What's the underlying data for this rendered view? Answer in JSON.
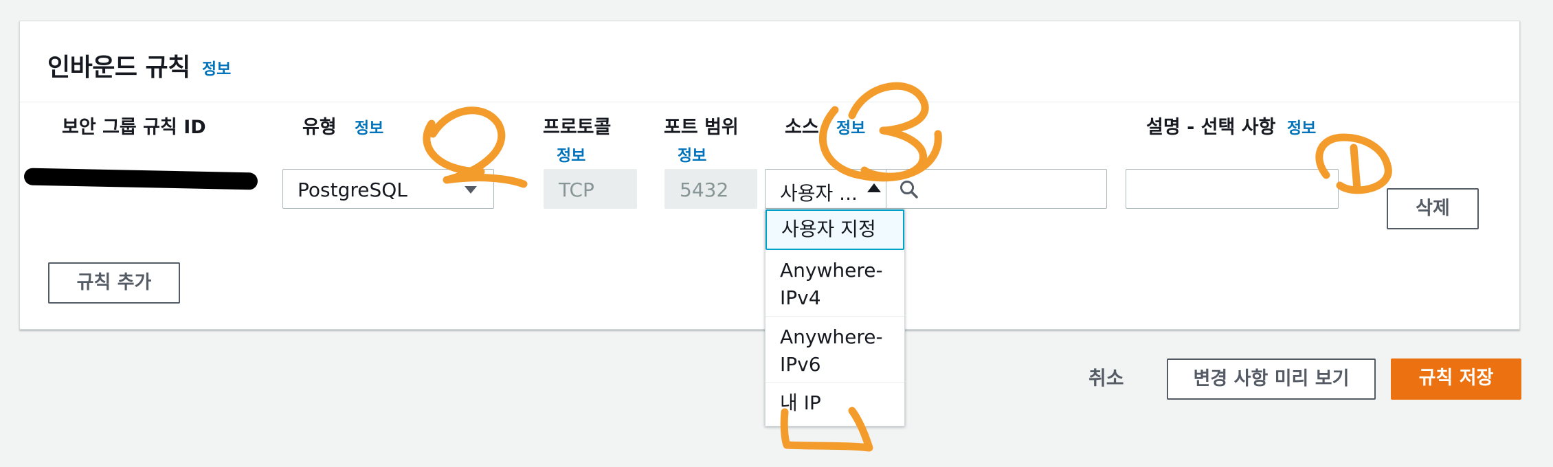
{
  "panel": {
    "title": "인바운드 규칙",
    "title_info": "정보"
  },
  "columns": {
    "rule_id": {
      "label": "보안 그룹 규칙 ID"
    },
    "type": {
      "label": "유형",
      "info": "정보"
    },
    "protocol": {
      "label": "프로토콜",
      "info": "정보"
    },
    "port_range": {
      "label": "포트 범위",
      "info": "정보"
    },
    "source": {
      "label": "소스",
      "info": "정보"
    },
    "description": {
      "label": "설명 - 선택 사항",
      "info": "정보"
    }
  },
  "rule": {
    "type_value": "PostgreSQL",
    "protocol_value": "TCP",
    "port_value": "5432",
    "source_value": "사용자 ...",
    "source_search_value": "",
    "description_value": "",
    "delete_label": "삭제"
  },
  "source_dropdown": {
    "options": [
      "사용자 지정",
      "Anywhere-IPv4",
      "Anywhere-IPv6",
      "내 IP"
    ],
    "highlighted": "사용자 지정"
  },
  "add_rule_label": "규칙 추가",
  "footer": {
    "cancel_label": "취소",
    "preview_label": "변경 사항 미리 보기",
    "save_label": "규칙 저장"
  },
  "annotations": {
    "marks": [
      "1",
      "2",
      "3"
    ],
    "color": "#f39c2b"
  },
  "colors": {
    "accent": "#ec7211",
    "link": "#0073bb",
    "focus": "#00a1c9"
  },
  "icons": [
    "search-icon",
    "caret-down-icon",
    "caret-up-icon"
  ]
}
